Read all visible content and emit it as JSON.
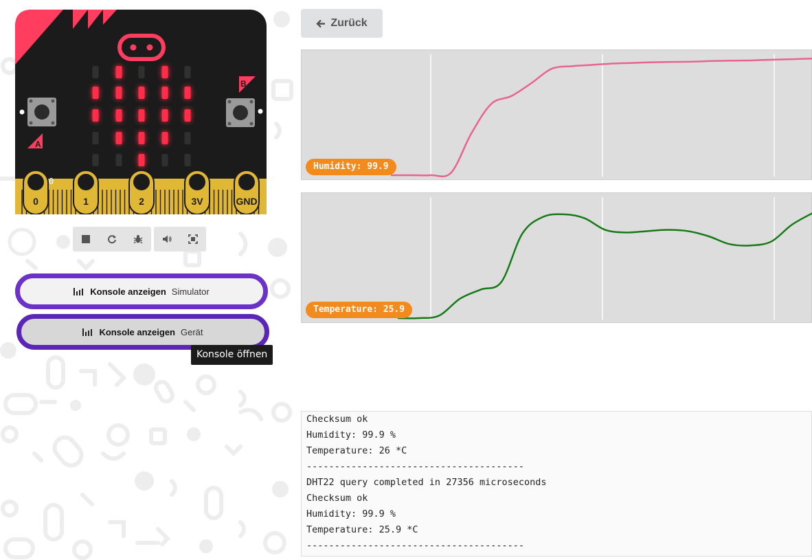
{
  "simulator": {
    "buttons": {
      "a": "A",
      "b": "B"
    },
    "pin_labels": [
      "0",
      "1",
      "2",
      "3V",
      "GND"
    ],
    "pin0_value": "0",
    "led_matrix": [
      [
        0,
        1,
        0,
        1,
        0
      ],
      [
        1,
        1,
        1,
        1,
        1
      ],
      [
        1,
        1,
        1,
        1,
        1
      ],
      [
        0,
        1,
        1,
        1,
        0
      ],
      [
        0,
        0,
        1,
        0,
        0
      ]
    ],
    "colors": {
      "board": "#1b1b1b",
      "accent": "#ff3d5f",
      "gold": "#e1b736",
      "led_on": "#ff2d4a",
      "led_off": "#303030"
    }
  },
  "controls": {
    "group1": [
      {
        "name": "stop-icon"
      },
      {
        "name": "restart-icon"
      },
      {
        "name": "debug-icon"
      }
    ],
    "group2": [
      {
        "name": "sound-icon"
      },
      {
        "name": "fullscreen-icon"
      }
    ]
  },
  "console_buttons": [
    {
      "label": "Konsole anzeigen",
      "source": "Simulator"
    },
    {
      "label": "Konsole anzeigen",
      "source": "Gerät"
    }
  ],
  "tooltip": "Konsole öffnen",
  "back_button": {
    "label": "Zurück",
    "icon": "arrow-left-icon"
  },
  "charts": {
    "humidity": {
      "label": "Humidity: 99.9",
      "color": "#e8638f"
    },
    "temperature": {
      "label": "Temperature: 25.9",
      "color": "#157a15"
    }
  },
  "chart_data": [
    {
      "type": "line",
      "series": [
        {
          "name": "Humidity",
          "values": [
            0,
            0,
            0,
            2,
            32,
            55,
            61,
            71,
            82,
            84,
            85,
            86,
            86.5,
            87,
            87.3,
            87.5,
            88,
            88.3,
            88.5,
            89,
            89.4,
            89.9
          ]
        }
      ]
    },
    {
      "type": "line",
      "series": [
        {
          "name": "Temperature",
          "values": [
            0,
            0,
            2,
            15,
            22,
            28,
            65,
            78,
            80,
            77,
            68,
            66,
            67,
            68,
            67,
            63,
            57,
            56,
            59,
            72,
            81
          ]
        }
      ]
    }
  ],
  "console_log": [
    "Checksum ok",
    "Humidity: 99.9 %",
    "Temperature: 26 *C",
    "---------------------------------------",
    "DHT22 query completed in 27356 microseconds",
    "Checksum ok",
    "Humidity: 99.9 %",
    "Temperature: 25.9 *C",
    "---------------------------------------"
  ]
}
